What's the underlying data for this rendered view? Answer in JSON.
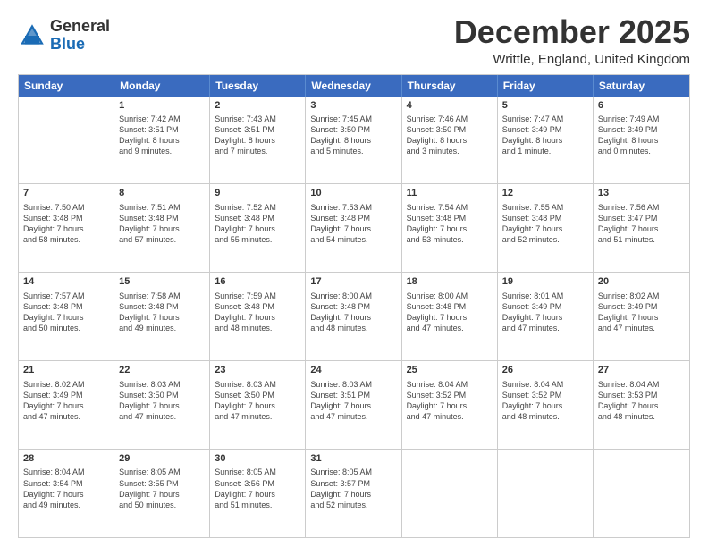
{
  "header": {
    "logo": {
      "general": "General",
      "blue": "Blue"
    },
    "title": "December 2025",
    "location": "Writtle, England, United Kingdom"
  },
  "days": [
    "Sunday",
    "Monday",
    "Tuesday",
    "Wednesday",
    "Thursday",
    "Friday",
    "Saturday"
  ],
  "weeks": [
    [
      {
        "day": "",
        "sunrise": "",
        "sunset": "",
        "daylight": ""
      },
      {
        "day": "1",
        "sunrise": "Sunrise: 7:42 AM",
        "sunset": "Sunset: 3:51 PM",
        "daylight": "Daylight: 8 hours and 9 minutes."
      },
      {
        "day": "2",
        "sunrise": "Sunrise: 7:43 AM",
        "sunset": "Sunset: 3:51 PM",
        "daylight": "Daylight: 8 hours and 7 minutes."
      },
      {
        "day": "3",
        "sunrise": "Sunrise: 7:45 AM",
        "sunset": "Sunset: 3:50 PM",
        "daylight": "Daylight: 8 hours and 5 minutes."
      },
      {
        "day": "4",
        "sunrise": "Sunrise: 7:46 AM",
        "sunset": "Sunset: 3:50 PM",
        "daylight": "Daylight: 8 hours and 3 minutes."
      },
      {
        "day": "5",
        "sunrise": "Sunrise: 7:47 AM",
        "sunset": "Sunset: 3:49 PM",
        "daylight": "Daylight: 8 hours and 1 minute."
      },
      {
        "day": "6",
        "sunrise": "Sunrise: 7:49 AM",
        "sunset": "Sunset: 3:49 PM",
        "daylight": "Daylight: 8 hours and 0 minutes."
      }
    ],
    [
      {
        "day": "7",
        "sunrise": "Sunrise: 7:50 AM",
        "sunset": "Sunset: 3:48 PM",
        "daylight": "Daylight: 7 hours and 58 minutes."
      },
      {
        "day": "8",
        "sunrise": "Sunrise: 7:51 AM",
        "sunset": "Sunset: 3:48 PM",
        "daylight": "Daylight: 7 hours and 57 minutes."
      },
      {
        "day": "9",
        "sunrise": "Sunrise: 7:52 AM",
        "sunset": "Sunset: 3:48 PM",
        "daylight": "Daylight: 7 hours and 55 minutes."
      },
      {
        "day": "10",
        "sunrise": "Sunrise: 7:53 AM",
        "sunset": "Sunset: 3:48 PM",
        "daylight": "Daylight: 7 hours and 54 minutes."
      },
      {
        "day": "11",
        "sunrise": "Sunrise: 7:54 AM",
        "sunset": "Sunset: 3:48 PM",
        "daylight": "Daylight: 7 hours and 53 minutes."
      },
      {
        "day": "12",
        "sunrise": "Sunrise: 7:55 AM",
        "sunset": "Sunset: 3:48 PM",
        "daylight": "Daylight: 7 hours and 52 minutes."
      },
      {
        "day": "13",
        "sunrise": "Sunrise: 7:56 AM",
        "sunset": "Sunset: 3:47 PM",
        "daylight": "Daylight: 7 hours and 51 minutes."
      }
    ],
    [
      {
        "day": "14",
        "sunrise": "Sunrise: 7:57 AM",
        "sunset": "Sunset: 3:48 PM",
        "daylight": "Daylight: 7 hours and 50 minutes."
      },
      {
        "day": "15",
        "sunrise": "Sunrise: 7:58 AM",
        "sunset": "Sunset: 3:48 PM",
        "daylight": "Daylight: 7 hours and 49 minutes."
      },
      {
        "day": "16",
        "sunrise": "Sunrise: 7:59 AM",
        "sunset": "Sunset: 3:48 PM",
        "daylight": "Daylight: 7 hours and 48 minutes."
      },
      {
        "day": "17",
        "sunrise": "Sunrise: 8:00 AM",
        "sunset": "Sunset: 3:48 PM",
        "daylight": "Daylight: 7 hours and 48 minutes."
      },
      {
        "day": "18",
        "sunrise": "Sunrise: 8:00 AM",
        "sunset": "Sunset: 3:48 PM",
        "daylight": "Daylight: 7 hours and 47 minutes."
      },
      {
        "day": "19",
        "sunrise": "Sunrise: 8:01 AM",
        "sunset": "Sunset: 3:49 PM",
        "daylight": "Daylight: 7 hours and 47 minutes."
      },
      {
        "day": "20",
        "sunrise": "Sunrise: 8:02 AM",
        "sunset": "Sunset: 3:49 PM",
        "daylight": "Daylight: 7 hours and 47 minutes."
      }
    ],
    [
      {
        "day": "21",
        "sunrise": "Sunrise: 8:02 AM",
        "sunset": "Sunset: 3:49 PM",
        "daylight": "Daylight: 7 hours and 47 minutes."
      },
      {
        "day": "22",
        "sunrise": "Sunrise: 8:03 AM",
        "sunset": "Sunset: 3:50 PM",
        "daylight": "Daylight: 7 hours and 47 minutes."
      },
      {
        "day": "23",
        "sunrise": "Sunrise: 8:03 AM",
        "sunset": "Sunset: 3:50 PM",
        "daylight": "Daylight: 7 hours and 47 minutes."
      },
      {
        "day": "24",
        "sunrise": "Sunrise: 8:03 AM",
        "sunset": "Sunset: 3:51 PM",
        "daylight": "Daylight: 7 hours and 47 minutes."
      },
      {
        "day": "25",
        "sunrise": "Sunrise: 8:04 AM",
        "sunset": "Sunset: 3:52 PM",
        "daylight": "Daylight: 7 hours and 47 minutes."
      },
      {
        "day": "26",
        "sunrise": "Sunrise: 8:04 AM",
        "sunset": "Sunset: 3:52 PM",
        "daylight": "Daylight: 7 hours and 48 minutes."
      },
      {
        "day": "27",
        "sunrise": "Sunrise: 8:04 AM",
        "sunset": "Sunset: 3:53 PM",
        "daylight": "Daylight: 7 hours and 48 minutes."
      }
    ],
    [
      {
        "day": "28",
        "sunrise": "Sunrise: 8:04 AM",
        "sunset": "Sunset: 3:54 PM",
        "daylight": "Daylight: 7 hours and 49 minutes."
      },
      {
        "day": "29",
        "sunrise": "Sunrise: 8:05 AM",
        "sunset": "Sunset: 3:55 PM",
        "daylight": "Daylight: 7 hours and 50 minutes."
      },
      {
        "day": "30",
        "sunrise": "Sunrise: 8:05 AM",
        "sunset": "Sunset: 3:56 PM",
        "daylight": "Daylight: 7 hours and 51 minutes."
      },
      {
        "day": "31",
        "sunrise": "Sunrise: 8:05 AM",
        "sunset": "Sunset: 3:57 PM",
        "daylight": "Daylight: 7 hours and 52 minutes."
      },
      {
        "day": "",
        "sunrise": "",
        "sunset": "",
        "daylight": ""
      },
      {
        "day": "",
        "sunrise": "",
        "sunset": "",
        "daylight": ""
      },
      {
        "day": "",
        "sunrise": "",
        "sunset": "",
        "daylight": ""
      }
    ]
  ]
}
